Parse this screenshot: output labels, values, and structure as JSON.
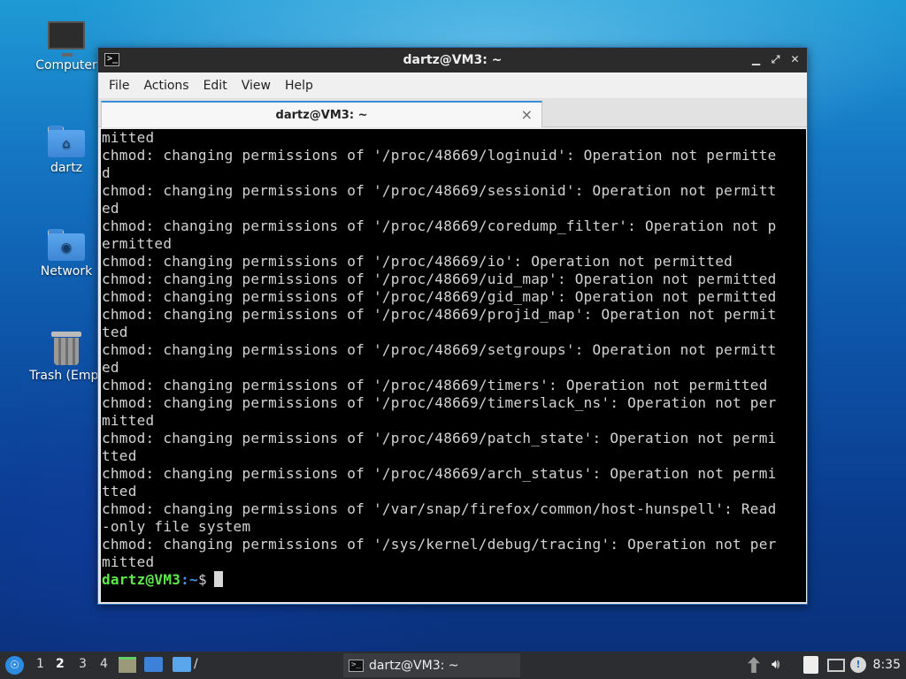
{
  "desktop": {
    "icons": [
      {
        "label": "Computer",
        "icon": "computer-icon"
      },
      {
        "label": "dartz",
        "icon": "home-folder-icon"
      },
      {
        "label": "Network",
        "icon": "network-folder-icon"
      },
      {
        "label": "Trash (Empt",
        "icon": "trash-icon"
      }
    ]
  },
  "window": {
    "title": "dartz@VM3: ~",
    "menu": [
      "File",
      "Actions",
      "Edit",
      "View",
      "Help"
    ],
    "tab_label": "dartz@VM3: ~",
    "tab_close": "×",
    "controls": {
      "minimize": "▁",
      "maximize": "⤢",
      "close": "✕"
    }
  },
  "terminal": {
    "lines": [
      "mitted",
      "chmod: changing permissions of '/proc/48669/loginuid': Operation not permitte",
      "d",
      "chmod: changing permissions of '/proc/48669/sessionid': Operation not permitt",
      "ed",
      "chmod: changing permissions of '/proc/48669/coredump_filter': Operation not p",
      "ermitted",
      "chmod: changing permissions of '/proc/48669/io': Operation not permitted",
      "chmod: changing permissions of '/proc/48669/uid_map': Operation not permitted",
      "chmod: changing permissions of '/proc/48669/gid_map': Operation not permitted",
      "chmod: changing permissions of '/proc/48669/projid_map': Operation not permit",
      "ted",
      "chmod: changing permissions of '/proc/48669/setgroups': Operation not permitt",
      "ed",
      "chmod: changing permissions of '/proc/48669/timers': Operation not permitted",
      "chmod: changing permissions of '/proc/48669/timerslack_ns': Operation not per",
      "mitted",
      "chmod: changing permissions of '/proc/48669/patch_state': Operation not permi",
      "tted",
      "chmod: changing permissions of '/proc/48669/arch_status': Operation not permi",
      "tted",
      "chmod: changing permissions of '/var/snap/firefox/common/host-hunspell': Read",
      "-only file system",
      "chmod: changing permissions of '/sys/kernel/debug/tracing': Operation not per",
      "mitted"
    ],
    "prompt_user": "dartz@VM3",
    "prompt_sep": ":",
    "prompt_path": "~",
    "prompt_symbol": "$"
  },
  "taskbar": {
    "workspaces": [
      "1",
      "2",
      "3",
      "4"
    ],
    "active_workspace": "2",
    "launcher_path_label": "/",
    "task_label": "dartz@VM3: ~",
    "clock": "8:35",
    "tray_icons": [
      "updates-icon",
      "volume-icon",
      "clipboard-icon",
      "network-icon",
      "notification-icon",
      "display-icon"
    ]
  },
  "colors": {
    "prompt_user": "#5fe84a",
    "prompt_path": "#4f8fe8",
    "tab_accent": "#3a8fd9",
    "window_border": "#2d6fb8"
  }
}
